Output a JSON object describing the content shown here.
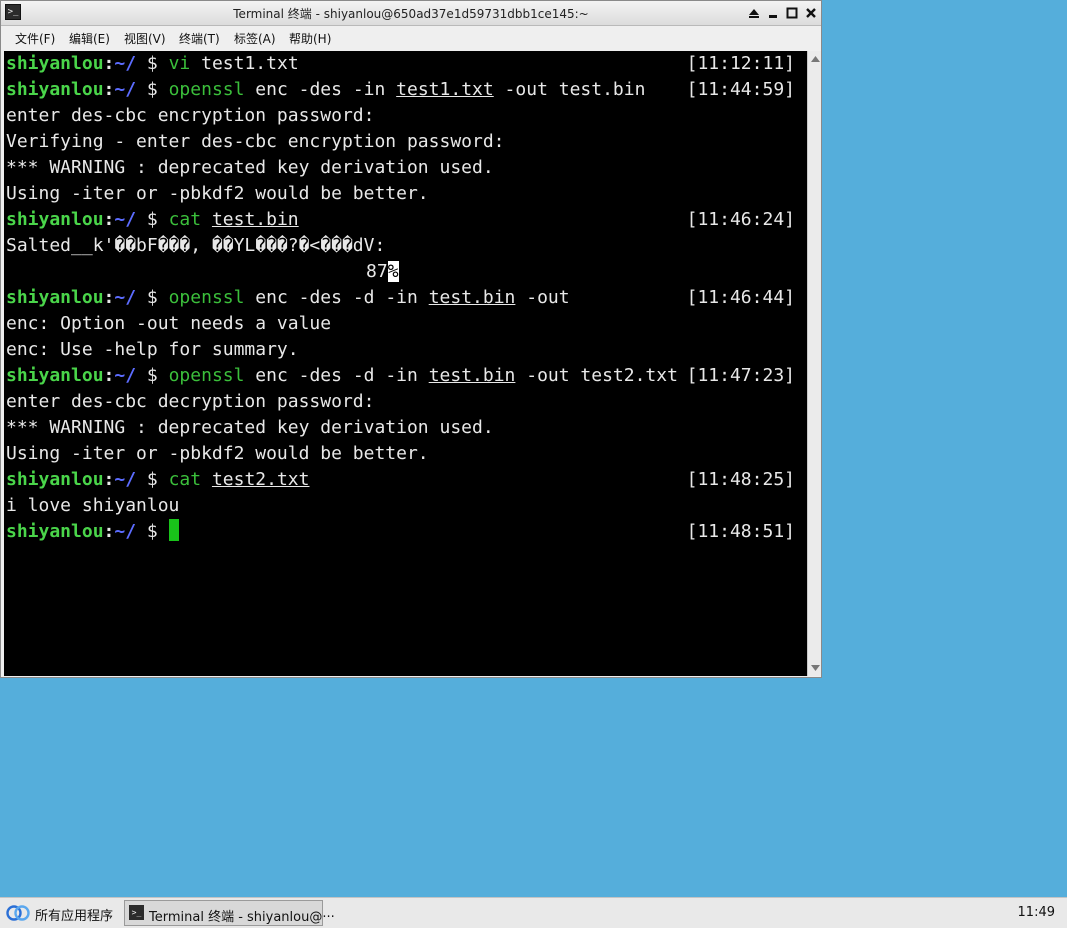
{
  "window": {
    "title": "Terminal 终端 - shiyanlou@650ad37e1d59731dbb1ce145:~",
    "app_icon": "terminal-icon",
    "controls": [
      "shade-icon",
      "minimize-icon",
      "maximize-icon",
      "close-icon"
    ]
  },
  "menu": [
    "文件(F)",
    "编辑(E)",
    "视图(V)",
    "终端(T)",
    "标签(A)",
    "帮助(H)"
  ],
  "prompt": {
    "user": "shiyanlou",
    "colon": ":",
    "path": "~/",
    "symbol": " $ "
  },
  "terminal": {
    "blocks": [
      {
        "cmd": "vi",
        "rest": " test1.txt",
        "ts": "[11:12:11]"
      },
      {
        "cmd": "openssl",
        "args1": " enc -des -in ",
        "file": "test1.txt",
        "args2": " -out test.bin",
        "ts": "[11:44:59]"
      },
      {
        "out": "enter des-cbc encryption password:"
      },
      {
        "out": "Verifying - enter des-cbc encryption password:"
      },
      {
        "out": "*** WARNING : deprecated key derivation used."
      },
      {
        "out": "Using -iter or -pbkdf2 would be better."
      },
      {
        "cmd": "cat",
        "file": "test.bin",
        "ts": "[11:46:24]"
      },
      {
        "out": "Salted__k'��bF���, ��YL���?�<���dV:"
      },
      {
        "out": "87",
        "inv": "%"
      },
      {
        "cmd": "openssl",
        "args1": " enc -des -d -in ",
        "file": "test.bin",
        "args2": " -out",
        "ts": "[11:46:44]"
      },
      {
        "out": "enc: Option -out needs a value"
      },
      {
        "out": "enc: Use -help for summary."
      },
      {
        "cmd": "openssl",
        "args1": " enc -des -d -in ",
        "file": "test.bin",
        "args2": " -out test2.txt",
        "ts": "[11:47:23]"
      },
      {
        "out": "enter des-cbc decryption password:"
      },
      {
        "out": "*** WARNING : deprecated key derivation used."
      },
      {
        "out": "Using -iter or -pbkdf2 would be better."
      },
      {
        "cmd": "cat",
        "file": "test2.txt",
        "ts": "[11:48:25]"
      },
      {
        "out": "i love shiyanlou"
      },
      {
        "ts": "[11:48:51]"
      }
    ]
  },
  "taskbar": {
    "start_label": "所有应用程序",
    "task_label": "Terminal 终端 - shiyanlou@···",
    "clock": "11:49"
  },
  "colors": {
    "desktop": "#55aedb",
    "prompt_user": "#4ad54a",
    "prompt_path": "#5c6cff",
    "command": "#3bbf3b",
    "cursor": "#19c41a"
  }
}
